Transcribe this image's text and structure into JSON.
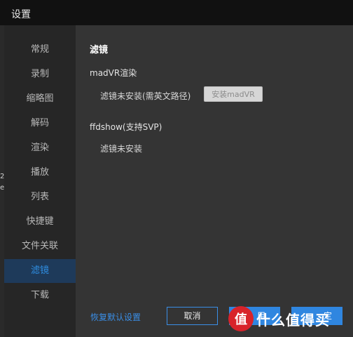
{
  "window": {
    "title": "设置"
  },
  "background": {
    "fragment_top": "2",
    "fragment_bottom": "e"
  },
  "sidebar": {
    "items": [
      {
        "label": "常规"
      },
      {
        "label": "录制"
      },
      {
        "label": "缩略图"
      },
      {
        "label": "解码"
      },
      {
        "label": "渲染"
      },
      {
        "label": "播放"
      },
      {
        "label": "列表"
      },
      {
        "label": "快捷键"
      },
      {
        "label": "文件关联"
      },
      {
        "label": "滤镜",
        "active": true
      },
      {
        "label": "下载"
      }
    ]
  },
  "content": {
    "section_title": "滤镜",
    "madvr": {
      "label": "madVR渲染",
      "status": "滤镜未安装(需英文路径)",
      "install_label": "安装madVR"
    },
    "ffdshow": {
      "label": "ffdshow(支持SVP)",
      "status": "滤镜未安装"
    }
  },
  "footer": {
    "restore_label": "恢复默认设置",
    "cancel_label": "取消",
    "apply_label": "用",
    "ok_label": "定"
  },
  "watermark": {
    "text": "值 什么值得买"
  },
  "colors": {
    "accent": "#2f86e0",
    "active_bg": "#1e3a5a",
    "content_bg": "#343434",
    "sidebar_bg": "#262626",
    "titlebar_bg": "#111111"
  }
}
